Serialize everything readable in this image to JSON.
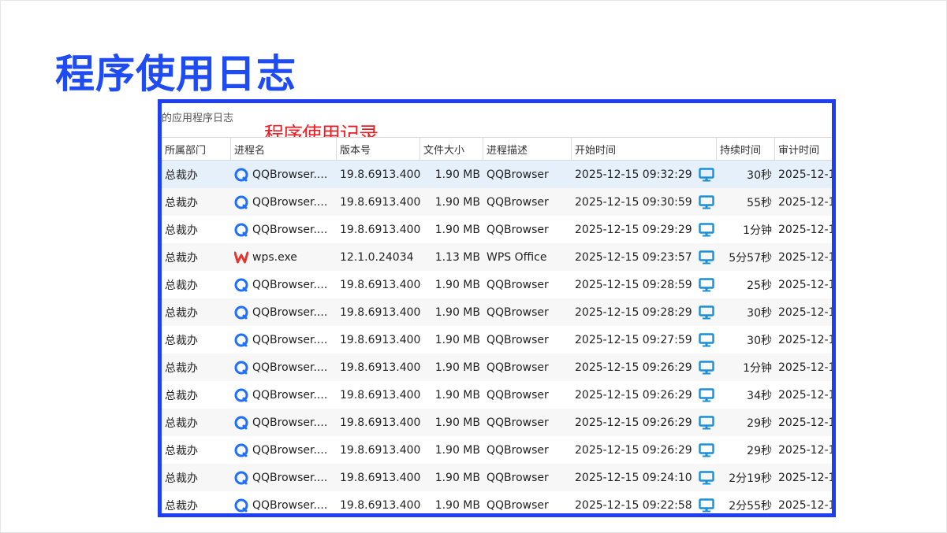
{
  "page": {
    "title": "程序使用日志"
  },
  "panel": {
    "title": "的应用程序日志",
    "overlay_label": "程序使用记录"
  },
  "colors": {
    "title_blue": "#1f4bf2",
    "frame_blue": "#1f3ff2",
    "overlay_red": "#ee1d24",
    "qq_icon_blue": "#1e6fff",
    "wps_icon_red": "#e8342f",
    "monitor_icon": "#1a8fd8"
  },
  "table": {
    "columns": [
      "所属部门",
      "进程名",
      "版本号",
      "文件大小",
      "进程描述",
      "开始时间",
      "持续时间",
      "审计时间"
    ],
    "rows": [
      {
        "dept": "总裁办",
        "icon": "qqbrowser-icon",
        "process": "QQBrowser....",
        "version": "19.8.6913.400",
        "size": "1.90 MB",
        "desc": "QQBrowser",
        "start": "2025-12-15 09:32:29",
        "duration": "30秒",
        "audit": "2025-12-1"
      },
      {
        "dept": "总裁办",
        "icon": "qqbrowser-icon",
        "process": "QQBrowser....",
        "version": "19.8.6913.400",
        "size": "1.90 MB",
        "desc": "QQBrowser",
        "start": "2025-12-15 09:30:59",
        "duration": "55秒",
        "audit": "2025-12-1"
      },
      {
        "dept": "总裁办",
        "icon": "qqbrowser-icon",
        "process": "QQBrowser....",
        "version": "19.8.6913.400",
        "size": "1.90 MB",
        "desc": "QQBrowser",
        "start": "2025-12-15 09:29:29",
        "duration": "1分钟",
        "audit": "2025-12-1"
      },
      {
        "dept": "总裁办",
        "icon": "wps-icon",
        "process": "wps.exe",
        "version": "12.1.0.24034",
        "size": "1.13 MB",
        "desc": "WPS Office",
        "start": "2025-12-15 09:23:57",
        "duration": "5分57秒",
        "audit": "2025-12-1"
      },
      {
        "dept": "总裁办",
        "icon": "qqbrowser-icon",
        "process": "QQBrowser....",
        "version": "19.8.6913.400",
        "size": "1.90 MB",
        "desc": "QQBrowser",
        "start": "2025-12-15 09:28:59",
        "duration": "25秒",
        "audit": "2025-12-1"
      },
      {
        "dept": "总裁办",
        "icon": "qqbrowser-icon",
        "process": "QQBrowser....",
        "version": "19.8.6913.400",
        "size": "1.90 MB",
        "desc": "QQBrowser",
        "start": "2025-12-15 09:28:29",
        "duration": "30秒",
        "audit": "2025-12-1"
      },
      {
        "dept": "总裁办",
        "icon": "qqbrowser-icon",
        "process": "QQBrowser....",
        "version": "19.8.6913.400",
        "size": "1.90 MB",
        "desc": "QQBrowser",
        "start": "2025-12-15 09:27:59",
        "duration": "30秒",
        "audit": "2025-12-1"
      },
      {
        "dept": "总裁办",
        "icon": "qqbrowser-icon",
        "process": "QQBrowser....",
        "version": "19.8.6913.400",
        "size": "1.90 MB",
        "desc": "QQBrowser",
        "start": "2025-12-15 09:26:29",
        "duration": "1分钟",
        "audit": "2025-12-1"
      },
      {
        "dept": "总裁办",
        "icon": "qqbrowser-icon",
        "process": "QQBrowser....",
        "version": "19.8.6913.400",
        "size": "1.90 MB",
        "desc": "QQBrowser",
        "start": "2025-12-15 09:26:29",
        "duration": "34秒",
        "audit": "2025-12-1"
      },
      {
        "dept": "总裁办",
        "icon": "qqbrowser-icon",
        "process": "QQBrowser....",
        "version": "19.8.6913.400",
        "size": "1.90 MB",
        "desc": "QQBrowser",
        "start": "2025-12-15 09:26:29",
        "duration": "29秒",
        "audit": "2025-12-1"
      },
      {
        "dept": "总裁办",
        "icon": "qqbrowser-icon",
        "process": "QQBrowser....",
        "version": "19.8.6913.400",
        "size": "1.90 MB",
        "desc": "QQBrowser",
        "start": "2025-12-15 09:26:29",
        "duration": "29秒",
        "audit": "2025-12-1"
      },
      {
        "dept": "总裁办",
        "icon": "qqbrowser-icon",
        "process": "QQBrowser....",
        "version": "19.8.6913.400",
        "size": "1.90 MB",
        "desc": "QQBrowser",
        "start": "2025-12-15 09:24:10",
        "duration": "2分19秒",
        "audit": "2025-12-1"
      },
      {
        "dept": "总裁办",
        "icon": "qqbrowser-icon",
        "process": "QQBrowser....",
        "version": "19.8.6913.400",
        "size": "1.90 MB",
        "desc": "QQBrowser",
        "start": "2025-12-15 09:22:58",
        "duration": "2分55秒",
        "audit": "2025-12-1"
      }
    ]
  }
}
